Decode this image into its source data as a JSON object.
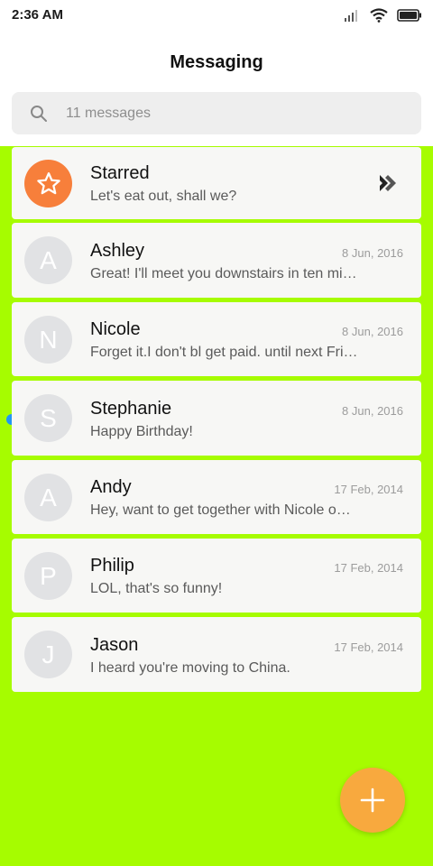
{
  "status_bar": {
    "time": "2:36 AM"
  },
  "header": {
    "title": "Messaging"
  },
  "search": {
    "placeholder": "11 messages"
  },
  "starred": {
    "title": "Starred",
    "preview": "Let's eat out, shall we?"
  },
  "conversations": [
    {
      "initial": "A",
      "name": "Ashley",
      "date": "8 Jun, 2016",
      "preview": "Great! I'll meet you downstairs in ten mi…",
      "unread": false
    },
    {
      "initial": "N",
      "name": "Nicole",
      "date": "8 Jun, 2016",
      "preview": "Forget it.I don't bl get paid. until next Fri…",
      "unread": false
    },
    {
      "initial": "S",
      "name": "Stephanie",
      "date": "8 Jun, 2016",
      "preview": "Happy Birthday!",
      "unread": true
    },
    {
      "initial": "A",
      "name": "Andy",
      "date": "17 Feb, 2014",
      "preview": "Hey, want to get together with Nicole o…",
      "unread": false
    },
    {
      "initial": "P",
      "name": "Philip",
      "date": "17 Feb, 2014",
      "preview": "LOL, that's so funny!",
      "unread": false
    },
    {
      "initial": "J",
      "name": "Jason",
      "date": "17 Feb, 2014",
      "preview": "I heard you're moving to China.",
      "unread": false
    }
  ],
  "colors": {
    "list_background": "#a6fc00",
    "starred_avatar": "#f77f3b",
    "fab": "#f8a93e",
    "unread_dot": "#2196f3"
  },
  "icons": {
    "search": "search-icon",
    "star": "star-icon",
    "chevron": "double-chevron-icon",
    "fab": "plus-icon"
  }
}
